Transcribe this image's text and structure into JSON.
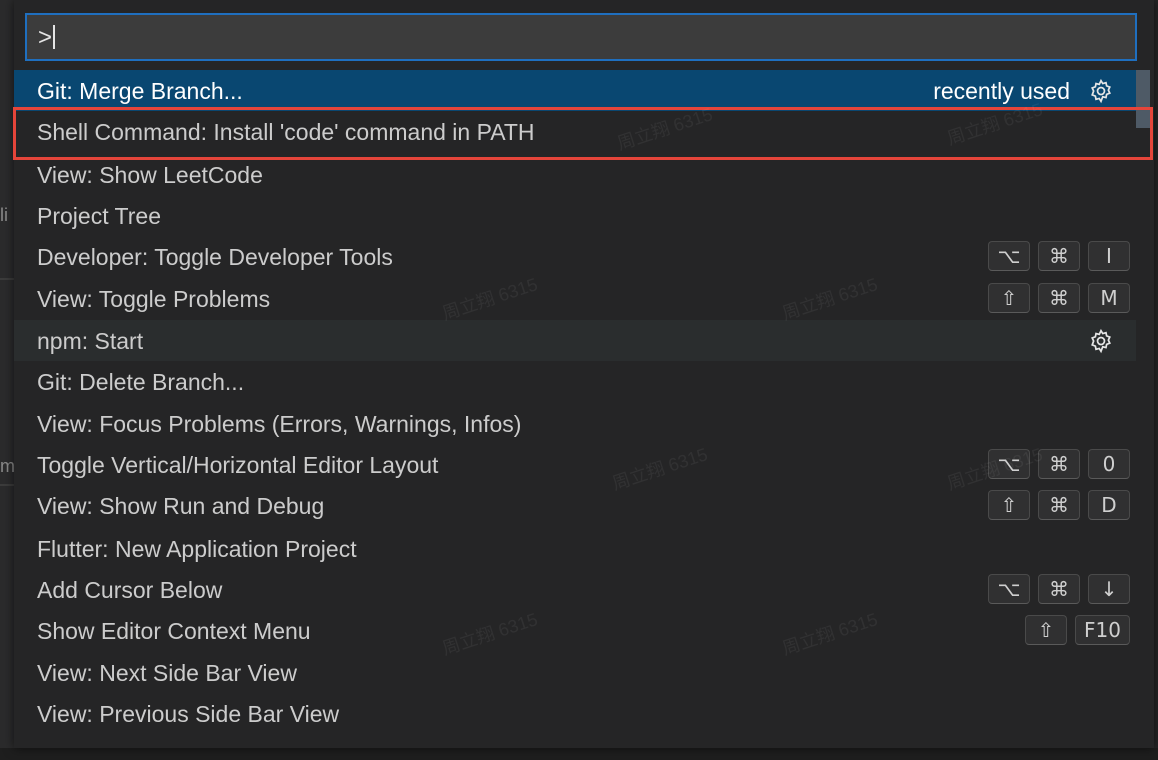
{
  "command_palette": {
    "input_value": ">",
    "items": [
      {
        "label": "Git: Merge Branch...",
        "badge": "recently used",
        "icon": "gear-icon",
        "state": "selected"
      },
      {
        "label": "Shell Command: Install 'code' command in PATH",
        "state": "highlighted"
      },
      {
        "label": "View: Show LeetCode"
      },
      {
        "label": "Project Tree"
      },
      {
        "label": "Developer: Toggle Developer Tools",
        "keys": [
          "⌥",
          "⌘",
          "I"
        ]
      },
      {
        "label": "View: Toggle Problems",
        "keys": [
          "⇧",
          "⌘",
          "M"
        ]
      },
      {
        "label": "npm: Start",
        "icon": "gear-icon",
        "state": "hover"
      },
      {
        "label": "Git: Delete Branch..."
      },
      {
        "label": "View: Focus Problems (Errors, Warnings, Infos)"
      },
      {
        "label": "Toggle Vertical/Horizontal Editor Layout",
        "keys": [
          "⌥",
          "⌘",
          "0"
        ]
      },
      {
        "label": "View: Show Run and Debug",
        "keys": [
          "⇧",
          "⌘",
          "D"
        ]
      },
      {
        "label": "Flutter: New Application Project"
      },
      {
        "label": "Add Cursor Below",
        "keys": [
          "⌥",
          "⌘",
          "↓"
        ]
      },
      {
        "label": "Show Editor Context Menu",
        "keys": [
          "⇧",
          "F10"
        ]
      },
      {
        "label": "View: Next Side Bar View"
      },
      {
        "label": "View: Previous Side Bar View"
      }
    ]
  },
  "background": {
    "edge_text_1": "li",
    "edge_text_2": "m",
    "watermark": "周立翔 6315"
  },
  "colors": {
    "selected_row": "#094771",
    "input_border": "#1f6fbf",
    "annotation_box": "#e5453a"
  }
}
